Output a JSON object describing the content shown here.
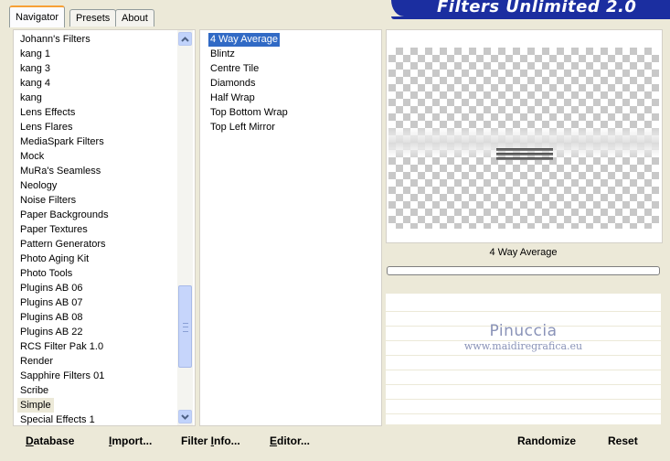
{
  "window": {
    "banner_title": "Filters Unlimited 2.0"
  },
  "tabs": [
    {
      "label": "Navigator",
      "active": true
    },
    {
      "label": "Presets",
      "active": false
    },
    {
      "label": "About",
      "active": false
    }
  ],
  "categories": {
    "items": [
      "Johann's Filters",
      "kang 1",
      "kang 3",
      "kang 4",
      "kang",
      "Lens Effects",
      "Lens Flares",
      "MediaSpark Filters",
      "Mock",
      "MuRa's Seamless",
      "Neology",
      "Noise Filters",
      "Paper Backgrounds",
      "Paper Textures",
      "Pattern Generators",
      "Photo Aging Kit",
      "Photo Tools",
      "Plugins AB 06",
      "Plugins AB 07",
      "Plugins AB 08",
      "Plugins AB 22",
      "RCS Filter Pak 1.0",
      "Render",
      "Sapphire Filters 01",
      "Scribe",
      "Simple",
      "Special Effects 1"
    ],
    "selected": "Simple"
  },
  "filters": {
    "items": [
      "4 Way Average",
      "Blintz",
      "Centre Tile",
      "Diamonds",
      "Half Wrap",
      "Top Bottom Wrap",
      "Top Left Mirror"
    ],
    "selected": "4 Way Average"
  },
  "preview": {
    "filter_name": "4 Way Average"
  },
  "watermark": {
    "line1": "Pinuccia",
    "line2": "www.maidiregrafica.eu"
  },
  "buttons": {
    "database": {
      "mnemonic": "D",
      "rest": "atabase"
    },
    "import": {
      "mnemonic": "I",
      "rest": "mport..."
    },
    "filter_info": {
      "pre": "Filter ",
      "mnemonic": "I",
      "rest": "nfo..."
    },
    "editor": {
      "mnemonic": "E",
      "rest": "ditor..."
    },
    "randomize": "Randomize",
    "reset": "Reset"
  },
  "colors": {
    "banner": "#1b2ea0",
    "selection": "#316ac5",
    "dialog_bg": "#ece9d8"
  }
}
